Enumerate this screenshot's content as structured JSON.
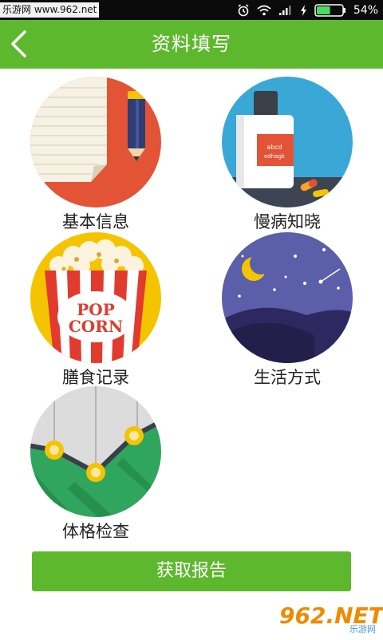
{
  "status_bar": {
    "watermark": "乐游网 www.962.net",
    "battery_percent": "54%",
    "battery_level": 0.54
  },
  "header": {
    "title": "资料填写"
  },
  "tiles": [
    {
      "label": "基本信息",
      "icon": "notebook-pencil-icon"
    },
    {
      "label": "慢病知晓",
      "icon": "medicine-bottle-icon"
    },
    {
      "label": "膳食记录",
      "icon": "popcorn-icon"
    },
    {
      "label": "生活方式",
      "icon": "night-moon-icon"
    },
    {
      "label": "体格检查",
      "icon": "line-chart-icon"
    }
  ],
  "bottle_label_line1": "abcd",
  "bottle_label_line2": "edhagk",
  "popcorn_text_line1": "POP",
  "popcorn_text_line2": "CORN",
  "report_button": "获取报告",
  "watermark_bottom": {
    "brand": "962.NET",
    "sub": "乐游网"
  },
  "colors": {
    "brand_green": "#5eb82e",
    "statusbar": "#0b0b0b"
  }
}
